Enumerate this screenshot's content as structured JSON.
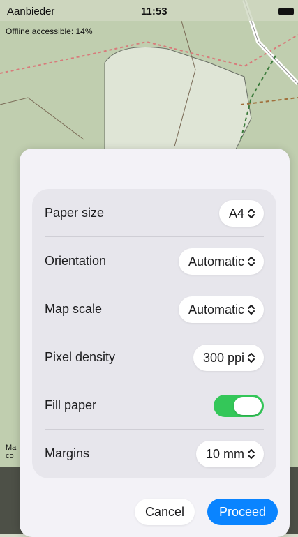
{
  "status_bar": {
    "carrier": "Aanbieder",
    "time": "11:53"
  },
  "map": {
    "offline_text": "Offline accessible: 14%",
    "attribution_line1": "Ma",
    "attribution_line2": "co"
  },
  "sheet": {
    "rows": [
      {
        "label": "Paper size",
        "value": "A4"
      },
      {
        "label": "Orientation",
        "value": "Automatic"
      },
      {
        "label": "Map scale",
        "value": "Automatic"
      },
      {
        "label": "Pixel density",
        "value": "300 ppi"
      },
      {
        "label": "Fill paper",
        "toggle_on": true
      },
      {
        "label": "Margins",
        "value": "10 mm"
      }
    ],
    "cancel_label": "Cancel",
    "proceed_label": "Proceed"
  },
  "colors": {
    "accent": "#0a84ff",
    "toggle_on": "#34c759",
    "map_green": "#c9d6b8"
  }
}
